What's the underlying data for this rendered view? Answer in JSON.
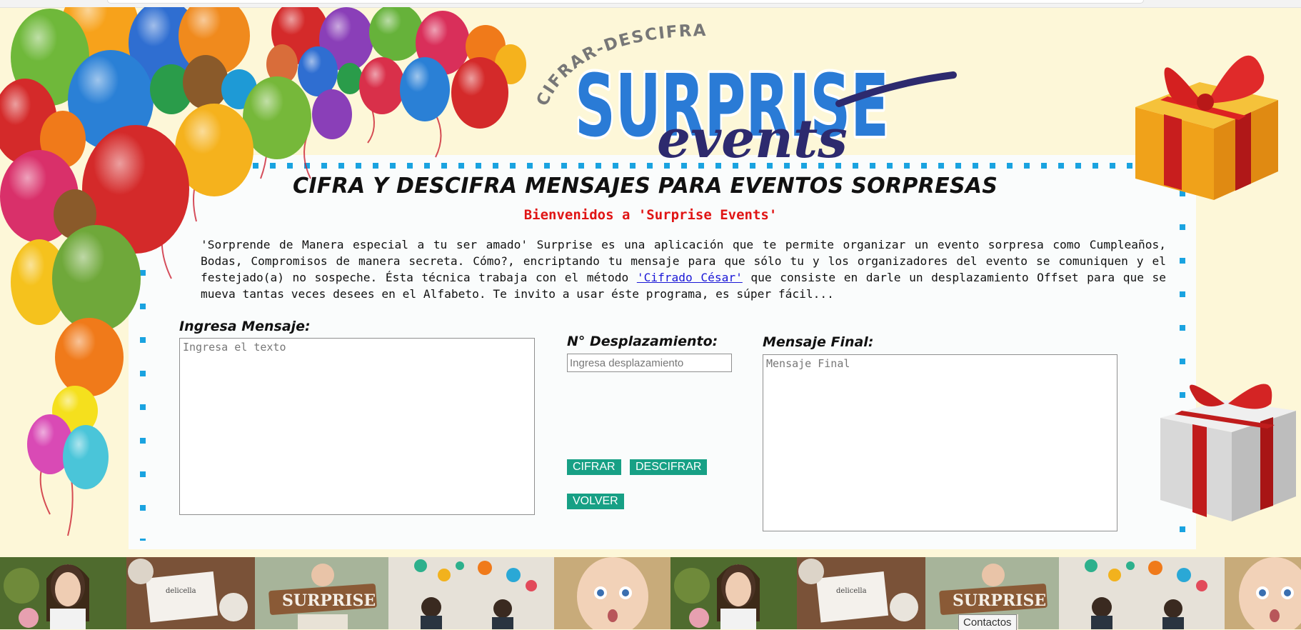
{
  "logo": {
    "arc_text": "CIFRAR-DESCIFRAR",
    "word_surprise": "SURPRISE",
    "word_events": "events"
  },
  "header": {
    "title": "CIFRA Y DESCIFRA MENSAJES PARA EVENTOS SORPRESAS",
    "welcome": "Bienvenidos a 'Surprise Events'"
  },
  "intro": {
    "text_before_link": "'Sorprende de Manera especial a tu ser amado' Surprise es una aplicación que te permite organizar un evento sorpresa como Cumpleaños, Bodas, Compromisos de manera secreta. Cómo?, encriptando tu mensaje para que sólo tu y los organizadores del evento se comuniquen y el festejado(a) no sospeche. Ésta técnica trabaja con el método ",
    "link_text": "'Cifrado César'",
    "text_after_link": " que consiste en darle un desplazamiento Offset para que se mueva tantas veces desees en el Alfabeto. Te invito a usar éste programa, es súper fácil..."
  },
  "form": {
    "message_label": "Ingresa Mensaje:",
    "message_placeholder": "Ingresa el texto",
    "offset_label": "N° Desplazamiento:",
    "offset_placeholder": "Ingresa desplazamiento",
    "result_label": "Mensaje Final:",
    "result_placeholder": "Mensaje Final",
    "encrypt_button": "CIFRAR",
    "decrypt_button": "DESCIFRAR",
    "back_button": "VOLVER"
  },
  "footer": {
    "surprise_sign_text": "SURPRISE",
    "card_text": "delicella",
    "contact_label": "Contactos"
  },
  "colors": {
    "background": "#fdf7d8",
    "title_red": "#e01414",
    "button_green": "#17a085",
    "dot_border": "#1aa3e0",
    "link_blue": "#1a17d6"
  }
}
